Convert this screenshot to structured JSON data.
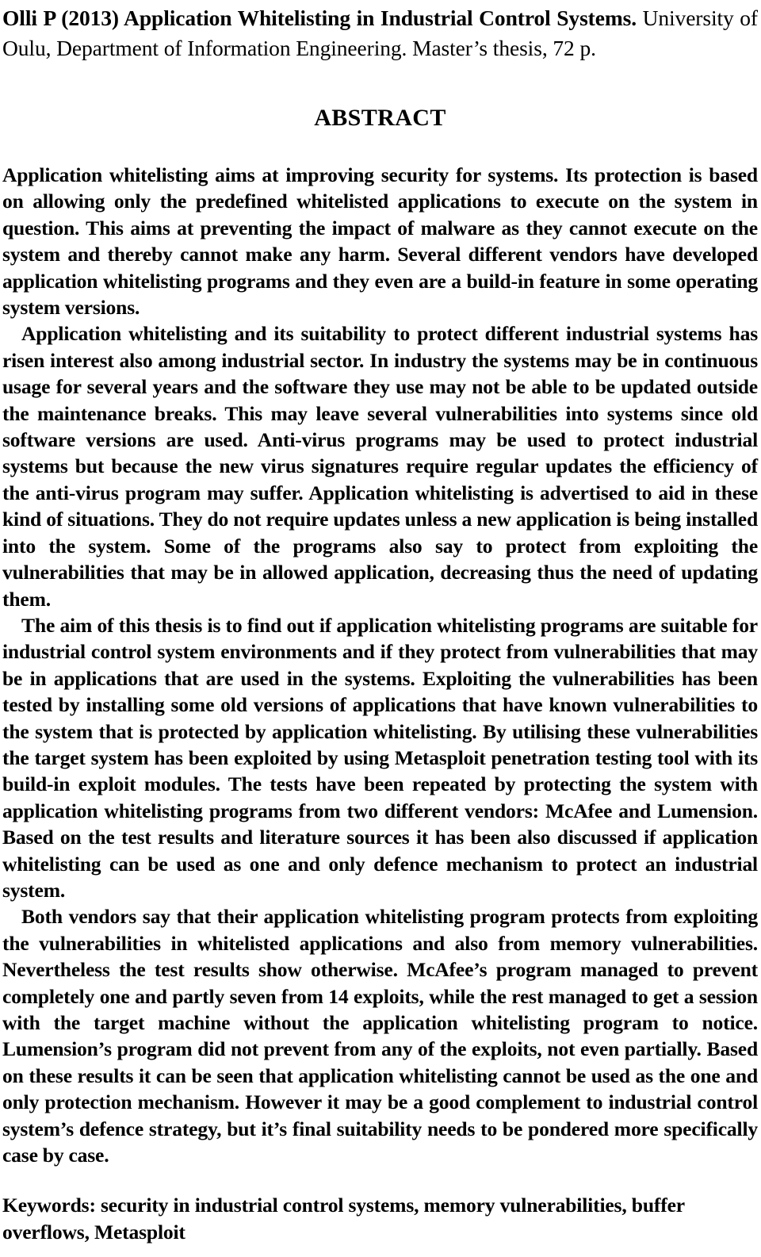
{
  "document": {
    "type": "thesis-abstract-page",
    "header": {
      "title": "Olli P (2013) Application Whitelisting in Industrial Control Systems.",
      "publication": " University of Oulu, Department of Information Engineering. Master’s thesis, 72 p."
    },
    "heading": "ABSTRACT",
    "paragraphs": [
      "Application whitelisting aims at improving security for systems. Its protection is based on allowing only the predefined whitelisted applications to execute on the system in question. This aims at preventing the impact of malware as they cannot execute on the system and thereby cannot make any harm. Several different vendors have developed application whitelisting programs and they even are a build-in feature in some operating system versions.",
      "Application whitelisting and its suitability to protect different industrial systems has risen interest also among industrial sector. In industry the systems may be in continuous usage for several years and the software they use may not be able to be updated outside the maintenance breaks. This may leave several vulnerabilities into systems since old software versions are used. Anti-virus programs may be used to protect industrial systems but because the new virus signatures require regular updates the efficiency of the anti-virus program may suffer. Application whitelisting is advertised to aid in these kind of situations. They do not require updates unless a new application is being installed into the system. Some of the programs also say to protect from exploiting the vulnerabilities that may be in allowed application, decreasing thus the need of updating them.",
      "The aim of this thesis is to find out if application whitelisting programs are suitable for industrial control system environments and if they protect from vulnerabilities that may be in applications that are used in the systems. Exploiting the vulnerabilities has been tested by installing some old versions of applications that have known vulnerabilities to the system that is protected by application whitelisting. By utilising these vulnerabilities the target system has been exploited by using Metasploit penetration testing tool with its build-in exploit modules. The tests have been repeated by protecting the system with application whitelisting programs from two different vendors: McAfee and Lumension. Based on the test results and literature sources it has been also discussed if application whitelisting can be used as one and only defence mechanism to protect an industrial system.",
      "Both vendors say that their application whitelisting program protects from exploiting the vulnerabilities in whitelisted applications and also from memory vulnerabilities. Nevertheless the test results show otherwise. McAfee’s program managed to prevent completely one and partly seven from 14 exploits, while the rest managed to get a session with the target machine without the application whitelisting program to notice. Lumension’s program did not prevent from any of the exploits, not even partially. Based on these results it can be seen that application whitelisting cannot be used as the one and only protection mechanism. However it may be a good complement to industrial control system’s defence strategy, but it’s final suitability needs to be pondered more specifically case by case."
    ],
    "keywords": "Keywords: security in industrial control systems, memory vulnerabilities, buffer overflows, Metasploit",
    "colors": {
      "text": "#000000",
      "background": "#ffffff"
    }
  }
}
